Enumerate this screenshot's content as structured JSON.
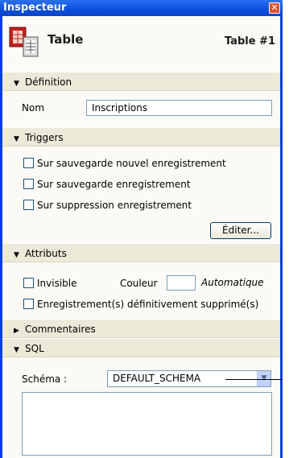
{
  "window": {
    "title": "Inspecteur",
    "close_glyph": "✕"
  },
  "header": {
    "icon": "table-icon",
    "title": "Table",
    "number": "Table #1"
  },
  "sections": {
    "definition": {
      "label": "Définition",
      "expanded": true
    },
    "triggers": {
      "label": "Triggers",
      "expanded": true
    },
    "attributs": {
      "label": "Attributs",
      "expanded": true
    },
    "commentaires": {
      "label": "Commentaires",
      "expanded": false
    },
    "sql": {
      "label": "SQL",
      "expanded": true
    }
  },
  "definition": {
    "name_label": "Nom",
    "name_value": "Inscriptions"
  },
  "triggers": {
    "items": [
      {
        "label": "Sur sauvegarde nouvel enregistrement",
        "checked": false
      },
      {
        "label": "Sur sauvegarde enregistrement",
        "checked": false
      },
      {
        "label": "Sur suppression enregistrement",
        "checked": false
      }
    ],
    "edit_button": "Éditer..."
  },
  "attributs": {
    "invisible_label": "Invisible",
    "invisible_checked": false,
    "color_label": "Couleur",
    "color_value": "Automatique",
    "deleted_label": "Enregistrement(s) définitivement supprimé(s)",
    "deleted_checked": false
  },
  "sql": {
    "schema_label": "Schéma :",
    "schema_value": "DEFAULT_SCHEMA"
  },
  "colors": {
    "titlebar": "#0a4fdc",
    "section_bg": "#ece9d8",
    "panel_bg": "#fbfaf6",
    "field_border": "#7f9db9"
  }
}
